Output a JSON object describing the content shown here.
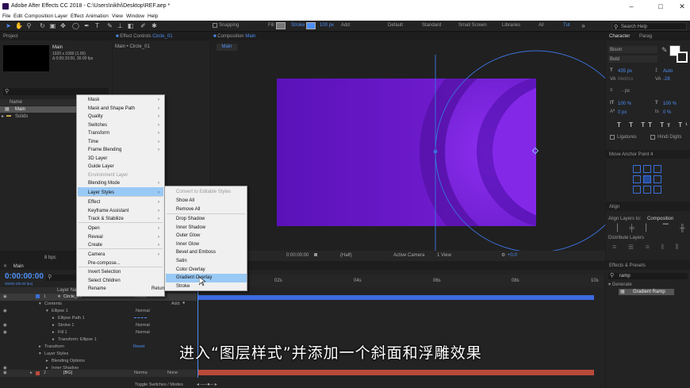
{
  "window": {
    "title": "Adobe After Effects CC 2018 - C:\\Users\\nikhi\\Desktop\\REF.aep *"
  },
  "menu": [
    "File",
    "Edit",
    "Composition",
    "Layer",
    "Effect",
    "Animation",
    "View",
    "Window",
    "Help"
  ],
  "toolbar": {
    "snapping": "Snapping",
    "fill": "Fill",
    "stroke": "Stroke",
    "stroke_width": "100 px",
    "add": "Add:",
    "workspaces": [
      "Default",
      "Standard",
      "Small Screen",
      "Libraries",
      "All",
      "Tut"
    ],
    "search_placeholder": "Search Help"
  },
  "project": {
    "tab": "Project",
    "comp_name": "Main",
    "comp_info1": "1920 x 1080 (1.00)",
    "comp_info2": "Δ 0;00;10;00, 30.00 fps",
    "col_name": "Name",
    "items": [
      "Main",
      "Solids"
    ],
    "bpc": "8 bpc"
  },
  "effect_controls": {
    "tab": "Effect Controls",
    "layer": "Circle_01",
    "breadcrumb": "Main • Circle_01"
  },
  "composition": {
    "tab": "Composition",
    "comp": "Main",
    "subtab": "Main",
    "timecode": "0:00:00:00",
    "resolution": "(Half)",
    "camera": "Active Camera",
    "view": "1 View",
    "exposure": "+0.0"
  },
  "context_menu": {
    "items": [
      {
        "label": "Mask",
        "sub": true
      },
      {
        "label": "Mask and Shape Path",
        "sub": true
      },
      {
        "label": "Quality",
        "sub": true
      },
      {
        "label": "Switches",
        "sub": true
      },
      {
        "label": "Transform",
        "sub": true
      },
      {
        "label": "Time",
        "sub": true
      },
      {
        "label": "Frame Blending",
        "sub": true
      },
      {
        "label": "3D Layer",
        "sub": false
      },
      {
        "label": "Guide Layer",
        "sub": false
      },
      {
        "label": "Environment Layer",
        "sub": false,
        "disabled": true
      },
      {
        "label": "Blending Mode",
        "sub": true
      },
      {
        "label": "Layer Styles",
        "sub": true,
        "highlighted": true
      },
      {
        "label": "Effect",
        "sub": true
      },
      {
        "label": "Keyframe Assistant",
        "sub": true
      },
      {
        "label": "Track & Stabilize",
        "sub": true
      },
      {
        "label": "Open",
        "sub": true
      },
      {
        "label": "Reveal",
        "sub": true
      },
      {
        "label": "Create",
        "sub": true
      },
      {
        "label": "Camera",
        "sub": true
      },
      {
        "label": "Pre-compose...",
        "sub": false
      },
      {
        "label": "Invert Selection",
        "sub": false
      },
      {
        "label": "Select Children",
        "sub": false
      },
      {
        "label": "Rename",
        "sub": false,
        "shortcut": "Return"
      }
    ]
  },
  "submenu": {
    "items": [
      {
        "label": "Convert to Editable Styles",
        "disabled": true
      },
      {
        "label": "Show All"
      },
      {
        "label": "Remove All"
      },
      {
        "label": "Drop Shadow"
      },
      {
        "label": "Inner Shadow"
      },
      {
        "label": "Outer Glow"
      },
      {
        "label": "Inner Glow"
      },
      {
        "label": "Bevel and Emboss"
      },
      {
        "label": "Satin"
      },
      {
        "label": "Color Overlay"
      },
      {
        "label": "Gradient Overlay",
        "highlighted": true
      },
      {
        "label": "Stroke"
      }
    ]
  },
  "timeline": {
    "tab": "Main",
    "timecode": "0:00:00:00",
    "frames": "00000 (30.00 fps)",
    "col_layer": "Layer Name",
    "ruler": [
      "0s",
      "02s",
      "04s",
      "06s",
      "08s",
      "10s"
    ],
    "rows": [
      {
        "num": "1",
        "name": "Circle_01",
        "mode": "Multipl"
      },
      {
        "name": "Contents",
        "extra": "Add:"
      },
      {
        "name": "Ellipse 1",
        "mode": "Normal"
      },
      {
        "name": "Ellipse Path 1"
      },
      {
        "name": "Stroke 1",
        "mode": "Normal"
      },
      {
        "name": "Fill 1",
        "mode": "Normal"
      },
      {
        "name": "Transform: Ellipse 1"
      },
      {
        "name": "Transform",
        "extra": "Reset"
      },
      {
        "name": "Layer Styles"
      },
      {
        "name": "Blending Options"
      },
      {
        "name": "Inner Shadow"
      },
      {
        "num": "2",
        "name": "[BG]",
        "mode": "Norma",
        "extra": "None"
      }
    ],
    "toggle": "Toggle Switches / Modes"
  },
  "character": {
    "tab": "Character",
    "tab2": "Parag",
    "font": "Bison",
    "style": "Bold",
    "size": "435 px",
    "leading": "Auto",
    "kerning": "Metrics",
    "tracking": "-28",
    "stroke": "- px",
    "vscale": "100 %",
    "hscale": "100 %",
    "baseline": "0 px",
    "tsume": "0 %",
    "ligatures": "Ligatures",
    "hindi": "Hindi Digits"
  },
  "anchor": {
    "title": "Move Anchor Point 4"
  },
  "align": {
    "tab": "Align",
    "align_to_label": "Align Layers to:",
    "align_to": "Composition",
    "distribute": "Distribute Layers"
  },
  "effects": {
    "tab": "Effects & Presets",
    "search": "ramp",
    "category": "Generate",
    "item": "Gradient Ramp"
  },
  "colors": {
    "comp_purple": "#8a22e0",
    "accent": "#4e8ff5",
    "label_red": "#c04a3c"
  },
  "caption": "进入“图层样式”并添加一个斜面和浮雕效果"
}
